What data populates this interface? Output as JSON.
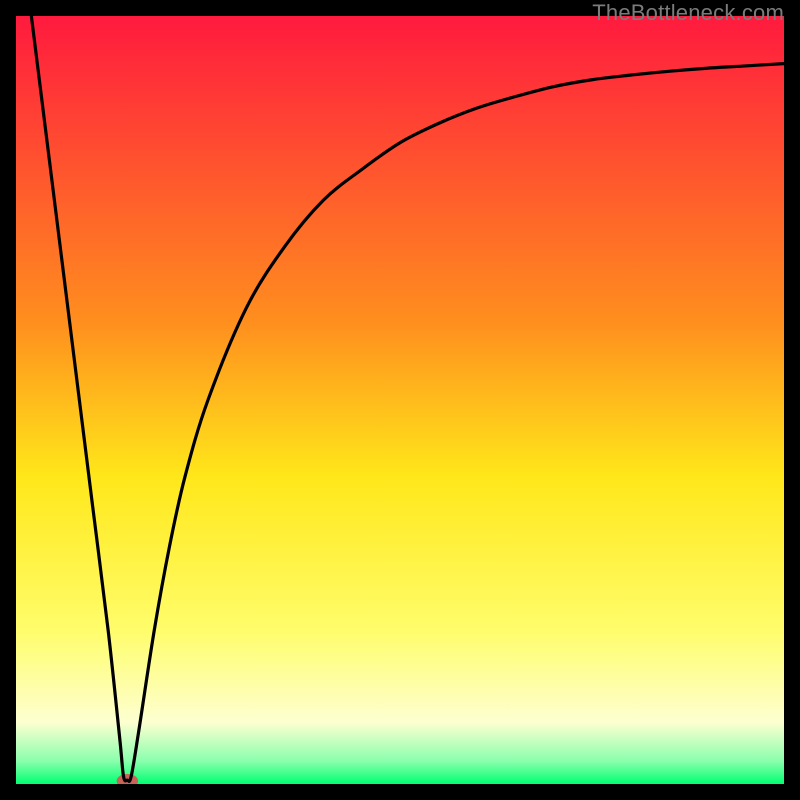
{
  "watermark": "TheBottleneck.com",
  "chart_data": {
    "type": "line",
    "title": "",
    "xlabel": "",
    "ylabel": "",
    "xlim": [
      0,
      100
    ],
    "ylim": [
      0,
      100
    ],
    "grid": false,
    "legend": false,
    "gradient_bands": [
      {
        "y": 0,
        "color": "#ff1a3e"
      },
      {
        "y": 40,
        "color": "#ff8f1e"
      },
      {
        "y": 60,
        "color": "#ffe71a"
      },
      {
        "y": 80,
        "color": "#fffd6b"
      },
      {
        "y": 92,
        "color": "#fdffd1"
      },
      {
        "y": 97,
        "color": "#8affad"
      },
      {
        "y": 100,
        "color": "#00ff71"
      }
    ],
    "series": [
      {
        "name": "bottleneck-curve",
        "type": "line",
        "color": "#000000",
        "x": [
          2.0,
          4,
          6,
          8,
          10,
          12,
          13.5,
          14,
          14.5,
          15,
          16,
          18,
          20,
          22,
          25,
          30,
          35,
          40,
          45,
          50,
          55,
          60,
          65,
          70,
          75,
          80,
          85,
          90,
          95,
          100
        ],
        "y": [
          100,
          84,
          68,
          52,
          36,
          20,
          6,
          1,
          0.5,
          1,
          7,
          20,
          31,
          40,
          50,
          62,
          70,
          76,
          80,
          83.5,
          86,
          88,
          89.5,
          90.8,
          91.7,
          92.3,
          92.8,
          93.2,
          93.5,
          93.8
        ]
      }
    ],
    "marker": {
      "name": "optimal-point",
      "x": 14.5,
      "y": 0.4,
      "rx": 1.4,
      "ry": 0.9,
      "color": "#c76357"
    }
  }
}
